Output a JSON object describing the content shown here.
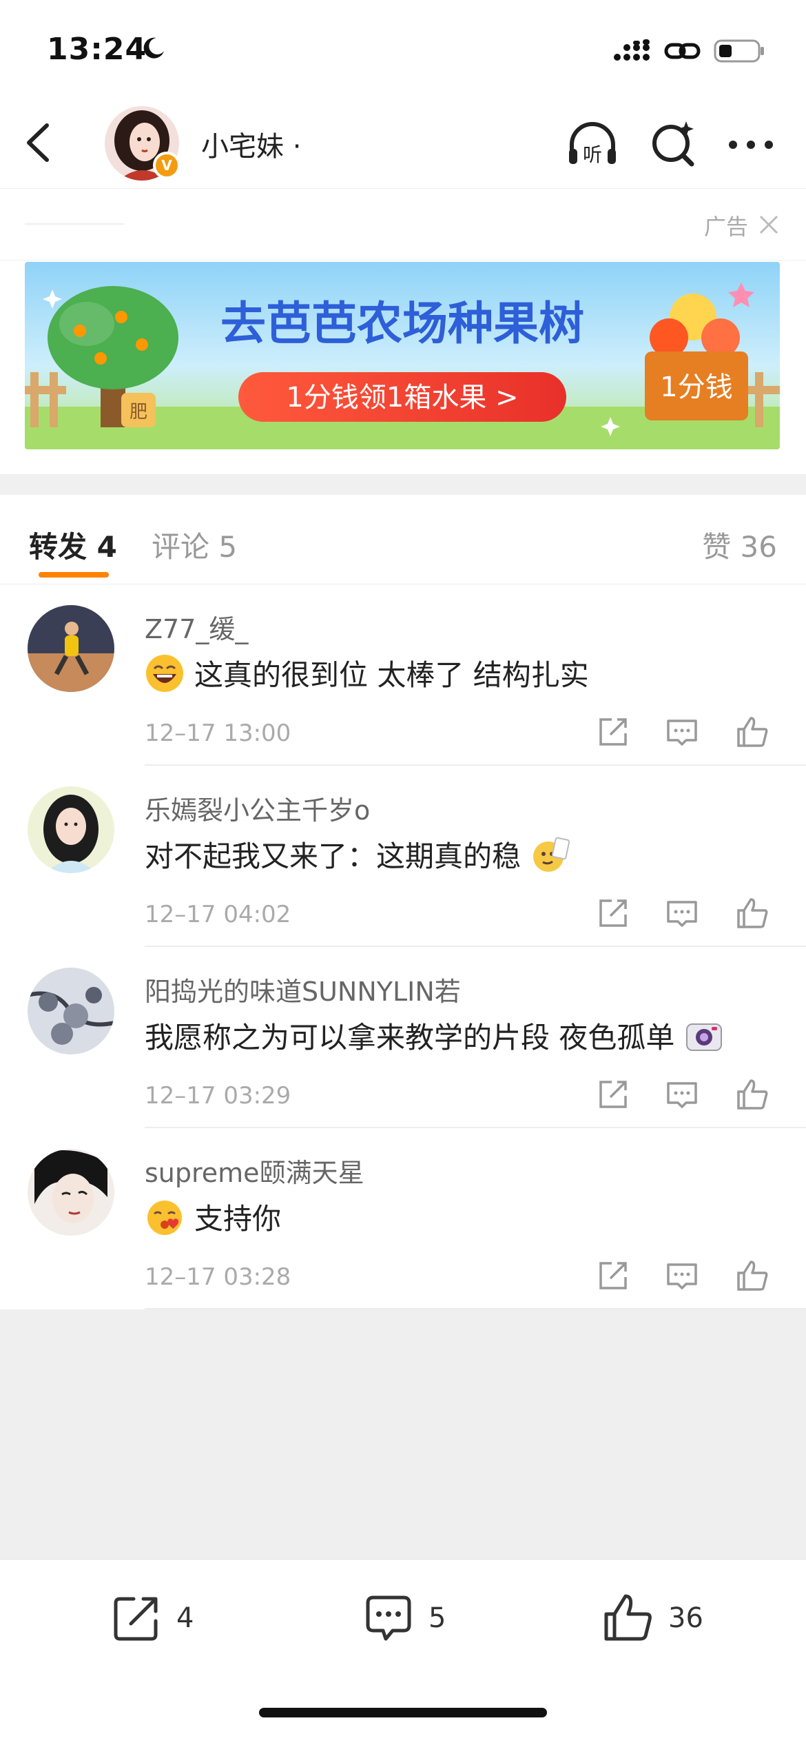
{
  "status_bar": {
    "time": "13:24"
  },
  "header": {
    "username": "小宅妹 ·",
    "listen_label": "听"
  },
  "ad": {
    "label": "广告",
    "banner_title": "去芭芭农场种果树",
    "banner_button": "1分钱领1箱水果 >",
    "banner_tag": "1分钱",
    "pot_label": "肥"
  },
  "tabs": {
    "repost": "转发 4",
    "comment": "评论 5",
    "like": "赞 36"
  },
  "comments": [
    {
      "name": "Z77_缓_",
      "text": "这真的很到位 太棒了 结构扎实",
      "time": "12–17 13:00",
      "emoji_position": "before",
      "emoji": "laughing-emoji"
    },
    {
      "name": "乐嫣裂小公主千岁o",
      "text": "对不起我又来了：这期真的稳",
      "time": "12–17 04:02",
      "emoji_position": "after",
      "emoji": "doge-card-emoji"
    },
    {
      "name": "阳捣光的味道SUNNYLIN若",
      "text": "我愿称之为可以拿来教学的片段 夜色孤单",
      "time": "12–17 03:29",
      "emoji_position": "after",
      "emoji": "camera-emoji"
    },
    {
      "name": "supreme颐满天星",
      "text": "支持你",
      "time": "12–17 03:28",
      "emoji_position": "before",
      "emoji": "heart-kiss-emoji"
    }
  ],
  "bottom_bar": {
    "repost_count": "4",
    "comment_count": "5",
    "like_count": "36"
  },
  "colors": {
    "accent": "#ff8200",
    "badge": "#f39c12",
    "muted": "#999999"
  }
}
